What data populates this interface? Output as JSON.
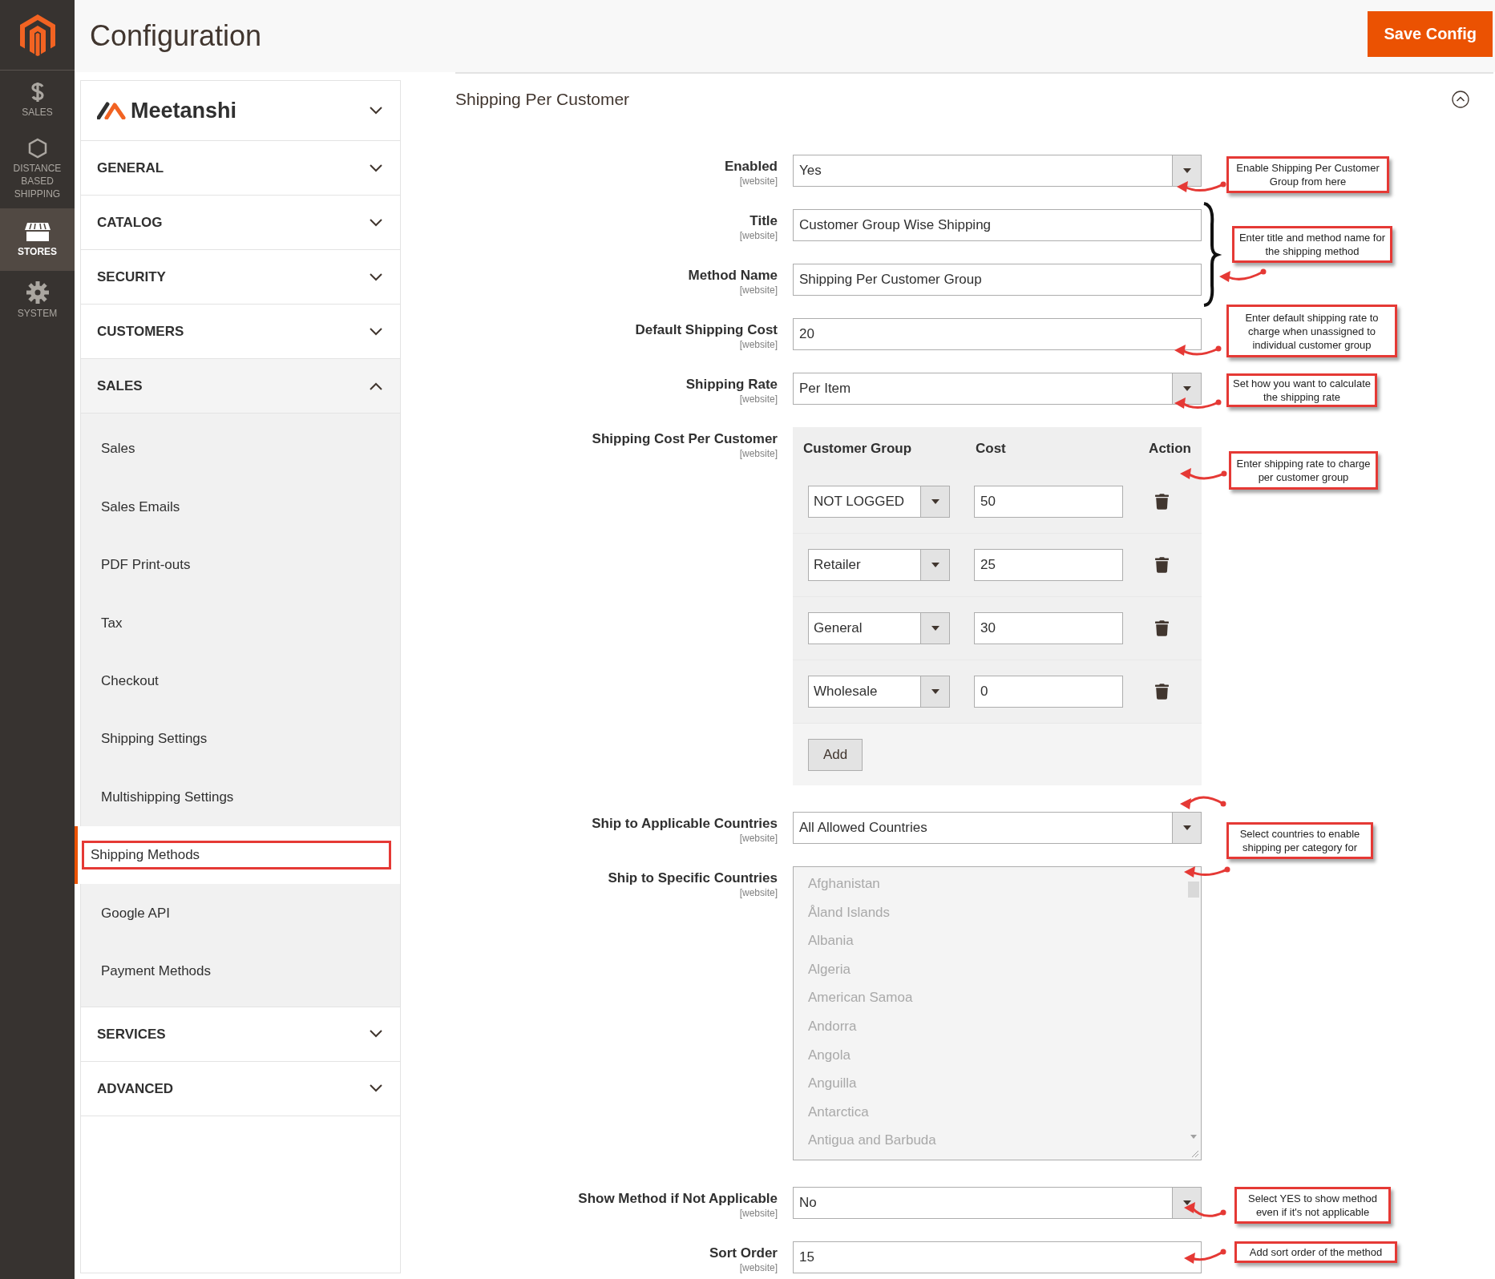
{
  "rail": {
    "items": [
      {
        "label": "SALES",
        "kind": "dollar",
        "selected": false
      },
      {
        "label": "DISTANCE BASED SHIPPING",
        "kind": "hexagon",
        "selected": false
      },
      {
        "label": "STORES",
        "kind": "store",
        "selected": true
      },
      {
        "label": "SYSTEM",
        "kind": "gear",
        "selected": false
      }
    ]
  },
  "header": {
    "title": "Configuration",
    "save_button": "Save Config"
  },
  "sidebar": {
    "brand": {
      "name": "Meetanshi",
      "expanded": false
    },
    "sections": [
      {
        "label": "GENERAL",
        "expanded": false
      },
      {
        "label": "CATALOG",
        "expanded": false
      },
      {
        "label": "SECURITY",
        "expanded": false
      },
      {
        "label": "CUSTOMERS",
        "expanded": false
      },
      {
        "label": "SALES",
        "expanded": true,
        "children": [
          {
            "label": "Sales",
            "selected": false
          },
          {
            "label": "Sales Emails",
            "selected": false
          },
          {
            "label": "PDF Print-outs",
            "selected": false
          },
          {
            "label": "Tax",
            "selected": false
          },
          {
            "label": "Checkout",
            "selected": false
          },
          {
            "label": "Shipping Settings",
            "selected": false
          },
          {
            "label": "Multishipping Settings",
            "selected": false
          },
          {
            "label": "Shipping Methods",
            "selected": true
          },
          {
            "label": "Google API",
            "selected": false
          },
          {
            "label": "Payment Methods",
            "selected": false
          }
        ]
      },
      {
        "label": "SERVICES",
        "expanded": false
      },
      {
        "label": "ADVANCED",
        "expanded": false
      }
    ]
  },
  "section": {
    "title": "Shipping Per Customer",
    "expanded": true,
    "fields": [
      {
        "kind": "select",
        "label": "Enabled",
        "scope": "[website]",
        "value": "Yes"
      },
      {
        "kind": "text",
        "label": "Title",
        "scope": "[website]",
        "value": "Customer Group Wise Shipping"
      },
      {
        "kind": "text",
        "label": "Method Name",
        "scope": "[website]",
        "value": "Shipping Per Customer Group"
      },
      {
        "kind": "text",
        "label": "Default Shipping Cost",
        "scope": "[website]",
        "value": "20"
      },
      {
        "kind": "select",
        "label": "Shipping Rate",
        "scope": "[website]",
        "value": "Per Item"
      },
      {
        "kind": "grid",
        "label": "Shipping Cost Per Customer",
        "scope": "[website]",
        "columns": [
          "Customer Group",
          "Cost",
          "Action"
        ],
        "rows": [
          {
            "group": "NOT LOGGED",
            "cost": "50"
          },
          {
            "group": "Retailer",
            "cost": "25"
          },
          {
            "group": "General",
            "cost": "30"
          },
          {
            "group": "Wholesale",
            "cost": "0"
          }
        ],
        "add_button": "Add"
      },
      {
        "kind": "select",
        "label": "Ship to Applicable Countries",
        "scope": "[website]",
        "value": "All Allowed Countries"
      },
      {
        "kind": "multiselect",
        "label": "Ship to Specific Countries",
        "scope": "[website]",
        "disabled": true,
        "options": [
          "Afghanistan",
          "Åland Islands",
          "Albania",
          "Algeria",
          "American Samoa",
          "Andorra",
          "Angola",
          "Anguilla",
          "Antarctica",
          "Antigua and Barbuda"
        ]
      },
      {
        "kind": "select",
        "label": "Show Method if Not Applicable",
        "scope": "[website]",
        "value": "No"
      },
      {
        "kind": "text",
        "label": "Sort Order",
        "scope": "[website]",
        "value": "15"
      }
    ]
  },
  "annotations": [
    {
      "text": "Enable Shipping Per Customer Group from here"
    },
    {
      "text": "Enter title and method name for the shipping method"
    },
    {
      "text": "Enter default shipping rate to charge when unassigned to individual customer group"
    },
    {
      "text": "Set how you want to calculate the shipping rate"
    },
    {
      "text": "Enter shipping rate to charge per customer group"
    },
    {
      "text": "Select countries to enable shipping per category for"
    },
    {
      "text": "Select YES to show method even if it's not applicable"
    },
    {
      "text": "Add sort order of the method"
    }
  ]
}
